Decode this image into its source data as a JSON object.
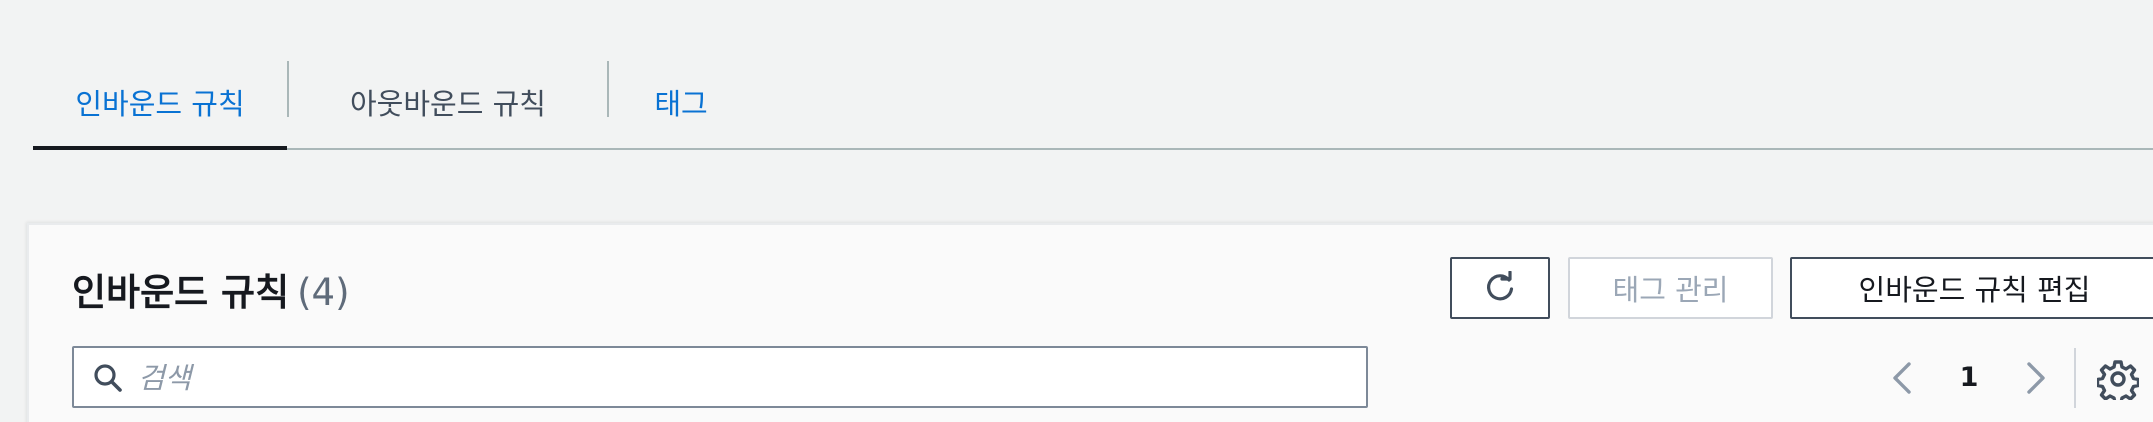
{
  "tabs": {
    "inbound": "인바운드 규칙",
    "outbound": "아웃바운드 규칙",
    "tags": "태그"
  },
  "panel": {
    "title": "인바운드 규칙",
    "count": "(4)",
    "refresh_icon": "refresh-icon",
    "manage_tags_label": "태그 관리",
    "edit_inbound_label": "인바운드 규칙 편집"
  },
  "search": {
    "placeholder": "검색",
    "value": "",
    "icon": "search-icon"
  },
  "pagination": {
    "current_page": "1",
    "prev_icon": "chevron-left-icon",
    "next_icon": "chevron-right-icon"
  },
  "settings": {
    "icon": "gear-icon"
  },
  "colors": {
    "background": "#f2f3f3",
    "panel": "#fafafa",
    "link_blue": "#0972d3",
    "text_dark": "#16191f",
    "text_secondary": "#414d5c",
    "disabled": "#9ba7b6",
    "border": "#aab7b8"
  }
}
